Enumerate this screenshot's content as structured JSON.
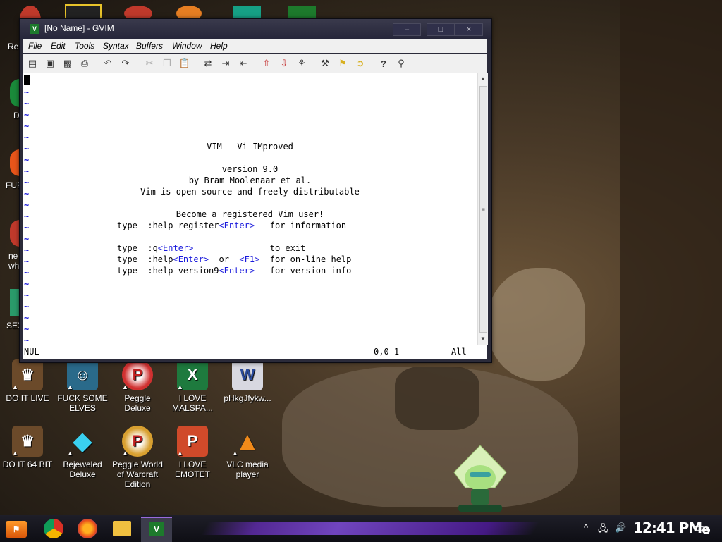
{
  "window": {
    "title": "[No Name] - GVIM",
    "icon": "vim-icon",
    "minimize": "–",
    "maximize": "□",
    "close": "×"
  },
  "menu": [
    "File",
    "Edit",
    "Tools",
    "Syntax",
    "Buffers",
    "Window",
    "Help"
  ],
  "toolbar": {
    "icons": [
      "open-icon",
      "save-icon",
      "save-all-icon",
      "print-icon",
      "undo-icon",
      "redo-icon",
      "cut-icon",
      "copy-icon",
      "paste-icon",
      "find-replace-icon",
      "find-next-icon",
      "find-prev-icon",
      "load-session-icon",
      "save-session-icon",
      "run-script-icon",
      "make-icon",
      "shell-icon",
      "tags-icon",
      "help-icon",
      "find-help-icon"
    ]
  },
  "intro": {
    "title": "VIM - Vi IMproved",
    "version": "version 9.0",
    "author": "by Bram Moolenaar et al.",
    "license": "Vim is open source and freely distributable",
    "register": "Become a registered Vim user!",
    "help_lines": [
      {
        "prefix": "type  :help register",
        "key": "<Enter>",
        "spacer": "   ",
        "desc": "for information"
      },
      {
        "prefix": "type  :q",
        "key": "<Enter>",
        "spacer": "               ",
        "desc": "to exit"
      },
      {
        "prefix": "type  :help",
        "key": "<Enter>",
        "mid": "  or  ",
        "key2": "<F1>",
        "spacer": "  ",
        "desc": "for on-line help"
      },
      {
        "prefix": "type  :help version9",
        "key": "<Enter>",
        "spacer": "   ",
        "desc": "for version info"
      }
    ]
  },
  "status": {
    "left": "NUL",
    "position": "0,0-1",
    "scroll": "All"
  },
  "desktop_icons": [
    {
      "label": "DO IT LIVE"
    },
    {
      "label": "FUCK SOME ELVES"
    },
    {
      "label": "Peggle Deluxe"
    },
    {
      "label": "I LOVE MALSPA..."
    },
    {
      "label": "pHkgJfykw..."
    },
    {
      "label": "DO IT 64 BIT"
    },
    {
      "label": "Bejeweled Deluxe"
    },
    {
      "label": "Peggle World of Warcraft Edition"
    },
    {
      "label": "I LOVE EMOTET"
    },
    {
      "label": "VLC media player"
    }
  ],
  "partial_labels": [
    "Re",
    "D",
    "FUF",
    "ne",
    "wh",
    "SEX"
  ],
  "taskbar": {
    "clock": "12:41 PM",
    "notification_count": "1"
  },
  "colors": {
    "vim_key_blue": "#1a1adc",
    "title_bar": "#2b2b3a",
    "taskbar_accent": "#7a4ad0"
  }
}
